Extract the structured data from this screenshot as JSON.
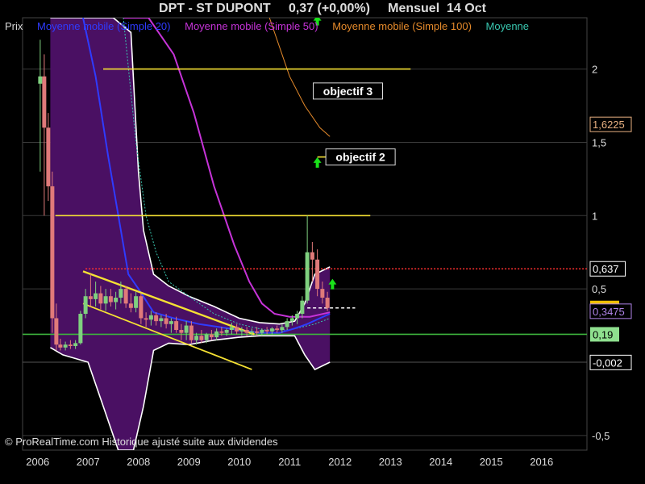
{
  "header": {
    "title": "DPT - ST DUPONT",
    "price_change": "0,37 (+0,00%)",
    "period": "Mensuel  14 Oct"
  },
  "legend": {
    "items": [
      {
        "label": "Prix",
        "color": "#d8d8d8"
      },
      {
        "label": "Moyenne mobile (Simple 20)",
        "color": "#2f3bff"
      },
      {
        "label": "Moyenne mobile (Simple 50)",
        "color": "#c633d8"
      },
      {
        "label": "Moyenne mobile (Simple 100)",
        "color": "#e58a2b"
      },
      {
        "label": "Moyenne",
        "color": "#39c7b0"
      }
    ]
  },
  "footer": {
    "credit": "© ProRealTime.com Historique ajusté suite aux dividendes"
  },
  "colors": {
    "background": "#000000",
    "band_fill": "#4a1063",
    "band_edge": "#ffffff",
    "up_candle": "#7fd07f",
    "down_candle": "#e07a7a",
    "trendline": "#f5e133",
    "support": "#3db33d",
    "resistance_dotted": "#ff3030",
    "arrow": "#19e019"
  },
  "chart_data": {
    "type": "candlestick",
    "xlim": [
      2005.7,
      2016.9
    ],
    "ylim": [
      -0.6,
      2.35
    ],
    "x_ticks": [
      {
        "x": 2006,
        "label": "2006"
      },
      {
        "x": 2007,
        "label": "2007"
      },
      {
        "x": 2008,
        "label": "2008"
      },
      {
        "x": 2009,
        "label": "2009"
      },
      {
        "x": 2010,
        "label": "2010"
      },
      {
        "x": 2011,
        "label": "2011"
      },
      {
        "x": 2012,
        "label": "2012"
      },
      {
        "x": 2013,
        "label": "2013"
      },
      {
        "x": 2014,
        "label": "2014"
      },
      {
        "x": 2015,
        "label": "2015"
      },
      {
        "x": 2016,
        "label": "2016"
      }
    ],
    "y_ticks": [
      {
        "y": 2,
        "label": "2"
      },
      {
        "y": 1.5,
        "label": "1,5"
      },
      {
        "y": 1,
        "label": "1"
      },
      {
        "y": 0.5,
        "label": "0,5"
      },
      {
        "y": -0.5,
        "label": "-0,5"
      }
    ],
    "price_tags": [
      {
        "y": 1.6225,
        "label": "1,6225",
        "style": "box",
        "color": "#e8b080"
      },
      {
        "y": 0.637,
        "label": "0,637",
        "style": "box",
        "color": "#ffffff"
      },
      {
        "y": 0.37,
        "label": "0,37",
        "style": "filled",
        "color": "#f0c000"
      },
      {
        "y": 0.3475,
        "label": "0,3475",
        "style": "box",
        "color": "#b084e8"
      },
      {
        "y": 0.19,
        "label": "0,19",
        "style": "filled",
        "color": "#8fe08f"
      },
      {
        "y": -0.002,
        "label": "-0,002",
        "style": "box",
        "color": "#ffffff"
      }
    ],
    "candles": [
      {
        "x": 2006.05,
        "o": 1.9,
        "h": 2.2,
        "l": 1.3,
        "c": 1.95
      },
      {
        "x": 2006.13,
        "o": 1.95,
        "h": 2.1,
        "l": 1.0,
        "c": 1.6
      },
      {
        "x": 2006.21,
        "o": 1.6,
        "h": 1.7,
        "l": 1.1,
        "c": 1.2
      },
      {
        "x": 2006.29,
        "o": 1.2,
        "h": 1.3,
        "l": 0.2,
        "c": 0.3
      },
      {
        "x": 2006.37,
        "o": 0.3,
        "h": 0.4,
        "l": 0.08,
        "c": 0.12
      },
      {
        "x": 2006.45,
        "o": 0.12,
        "h": 0.16,
        "l": 0.08,
        "c": 0.1
      },
      {
        "x": 2006.55,
        "o": 0.1,
        "h": 0.14,
        "l": 0.08,
        "c": 0.12
      },
      {
        "x": 2006.65,
        "o": 0.12,
        "h": 0.15,
        "l": 0.09,
        "c": 0.11
      },
      {
        "x": 2006.75,
        "o": 0.11,
        "h": 0.15,
        "l": 0.09,
        "c": 0.13
      },
      {
        "x": 2006.85,
        "o": 0.13,
        "h": 0.35,
        "l": 0.12,
        "c": 0.33
      },
      {
        "x": 2006.95,
        "o": 0.33,
        "h": 0.5,
        "l": 0.3,
        "c": 0.45
      },
      {
        "x": 2007.05,
        "o": 0.45,
        "h": 0.6,
        "l": 0.38,
        "c": 0.43
      },
      {
        "x": 2007.15,
        "o": 0.43,
        "h": 0.55,
        "l": 0.38,
        "c": 0.47
      },
      {
        "x": 2007.25,
        "o": 0.47,
        "h": 0.52,
        "l": 0.36,
        "c": 0.4
      },
      {
        "x": 2007.35,
        "o": 0.4,
        "h": 0.5,
        "l": 0.35,
        "c": 0.45
      },
      {
        "x": 2007.45,
        "o": 0.45,
        "h": 0.5,
        "l": 0.38,
        "c": 0.41
      },
      {
        "x": 2007.55,
        "o": 0.41,
        "h": 0.48,
        "l": 0.36,
        "c": 0.44
      },
      {
        "x": 2007.65,
        "o": 0.44,
        "h": 0.55,
        "l": 0.4,
        "c": 0.5
      },
      {
        "x": 2007.75,
        "o": 0.5,
        "h": 0.52,
        "l": 0.37,
        "c": 0.4
      },
      {
        "x": 2007.85,
        "o": 0.4,
        "h": 0.47,
        "l": 0.34,
        "c": 0.37
      },
      {
        "x": 2007.95,
        "o": 0.37,
        "h": 0.48,
        "l": 0.34,
        "c": 0.45
      },
      {
        "x": 2008.05,
        "o": 0.45,
        "h": 0.47,
        "l": 0.26,
        "c": 0.3
      },
      {
        "x": 2008.15,
        "o": 0.3,
        "h": 0.34,
        "l": 0.24,
        "c": 0.29
      },
      {
        "x": 2008.25,
        "o": 0.29,
        "h": 0.35,
        "l": 0.25,
        "c": 0.32
      },
      {
        "x": 2008.35,
        "o": 0.32,
        "h": 0.34,
        "l": 0.25,
        "c": 0.28
      },
      {
        "x": 2008.45,
        "o": 0.28,
        "h": 0.32,
        "l": 0.24,
        "c": 0.3
      },
      {
        "x": 2008.55,
        "o": 0.3,
        "h": 0.33,
        "l": 0.23,
        "c": 0.26
      },
      {
        "x": 2008.65,
        "o": 0.26,
        "h": 0.3,
        "l": 0.2,
        "c": 0.28
      },
      {
        "x": 2008.75,
        "o": 0.28,
        "h": 0.31,
        "l": 0.2,
        "c": 0.22
      },
      {
        "x": 2008.85,
        "o": 0.22,
        "h": 0.26,
        "l": 0.15,
        "c": 0.2
      },
      {
        "x": 2008.95,
        "o": 0.2,
        "h": 0.28,
        "l": 0.15,
        "c": 0.25
      },
      {
        "x": 2009.05,
        "o": 0.25,
        "h": 0.28,
        "l": 0.13,
        "c": 0.15
      },
      {
        "x": 2009.15,
        "o": 0.15,
        "h": 0.2,
        "l": 0.12,
        "c": 0.18
      },
      {
        "x": 2009.25,
        "o": 0.18,
        "h": 0.22,
        "l": 0.13,
        "c": 0.15
      },
      {
        "x": 2009.35,
        "o": 0.15,
        "h": 0.2,
        "l": 0.13,
        "c": 0.19
      },
      {
        "x": 2009.45,
        "o": 0.19,
        "h": 0.22,
        "l": 0.15,
        "c": 0.17
      },
      {
        "x": 2009.55,
        "o": 0.17,
        "h": 0.23,
        "l": 0.15,
        "c": 0.21
      },
      {
        "x": 2009.65,
        "o": 0.21,
        "h": 0.24,
        "l": 0.18,
        "c": 0.2
      },
      {
        "x": 2009.75,
        "o": 0.2,
        "h": 0.23,
        "l": 0.18,
        "c": 0.22
      },
      {
        "x": 2009.85,
        "o": 0.22,
        "h": 0.27,
        "l": 0.19,
        "c": 0.24
      },
      {
        "x": 2009.95,
        "o": 0.24,
        "h": 0.26,
        "l": 0.19,
        "c": 0.21
      },
      {
        "x": 2010.05,
        "o": 0.21,
        "h": 0.24,
        "l": 0.18,
        "c": 0.22
      },
      {
        "x": 2010.15,
        "o": 0.22,
        "h": 0.24,
        "l": 0.18,
        "c": 0.2
      },
      {
        "x": 2010.25,
        "o": 0.2,
        "h": 0.23,
        "l": 0.18,
        "c": 0.21
      },
      {
        "x": 2010.35,
        "o": 0.21,
        "h": 0.24,
        "l": 0.18,
        "c": 0.2
      },
      {
        "x": 2010.45,
        "o": 0.2,
        "h": 0.23,
        "l": 0.18,
        "c": 0.22
      },
      {
        "x": 2010.55,
        "o": 0.22,
        "h": 0.24,
        "l": 0.19,
        "c": 0.21
      },
      {
        "x": 2010.65,
        "o": 0.21,
        "h": 0.24,
        "l": 0.19,
        "c": 0.23
      },
      {
        "x": 2010.75,
        "o": 0.23,
        "h": 0.25,
        "l": 0.2,
        "c": 0.22
      },
      {
        "x": 2010.85,
        "o": 0.22,
        "h": 0.26,
        "l": 0.2,
        "c": 0.24
      },
      {
        "x": 2010.95,
        "o": 0.24,
        "h": 0.3,
        "l": 0.22,
        "c": 0.28
      },
      {
        "x": 2011.05,
        "o": 0.28,
        "h": 0.32,
        "l": 0.25,
        "c": 0.3
      },
      {
        "x": 2011.15,
        "o": 0.3,
        "h": 0.35,
        "l": 0.26,
        "c": 0.33
      },
      {
        "x": 2011.25,
        "o": 0.33,
        "h": 0.45,
        "l": 0.3,
        "c": 0.42
      },
      {
        "x": 2011.35,
        "o": 0.42,
        "h": 1.0,
        "l": 0.4,
        "c": 0.75
      },
      {
        "x": 2011.45,
        "o": 0.75,
        "h": 0.82,
        "l": 0.55,
        "c": 0.7
      },
      {
        "x": 2011.55,
        "o": 0.7,
        "h": 0.77,
        "l": 0.45,
        "c": 0.5
      },
      {
        "x": 2011.65,
        "o": 0.5,
        "h": 0.55,
        "l": 0.4,
        "c": 0.44
      },
      {
        "x": 2011.75,
        "o": 0.44,
        "h": 0.48,
        "l": 0.35,
        "c": 0.37
      }
    ],
    "bollinger": {
      "upper": [
        [
          2006.25,
          2.35
        ],
        [
          2006.5,
          2.35
        ],
        [
          2007,
          2.35
        ],
        [
          2007.5,
          2.35
        ],
        [
          2007.85,
          2.25
        ],
        [
          2008,
          1.3
        ],
        [
          2008.1,
          0.9
        ],
        [
          2008.3,
          0.6
        ],
        [
          2008.6,
          0.52
        ],
        [
          2009,
          0.45
        ],
        [
          2009.5,
          0.38
        ],
        [
          2010,
          0.3
        ],
        [
          2010.4,
          0.27
        ],
        [
          2010.8,
          0.26
        ],
        [
          2011.1,
          0.28
        ],
        [
          2011.3,
          0.4
        ],
        [
          2011.5,
          0.6
        ],
        [
          2011.8,
          0.65
        ]
      ],
      "lower": [
        [
          2006.25,
          0.1
        ],
        [
          2006.5,
          0.05
        ],
        [
          2007,
          0.0
        ],
        [
          2007.3,
          -0.3
        ],
        [
          2007.6,
          -0.6
        ],
        [
          2007.9,
          -0.6
        ],
        [
          2008.1,
          -0.3
        ],
        [
          2008.3,
          0.08
        ],
        [
          2008.6,
          0.13
        ],
        [
          2009,
          0.12
        ],
        [
          2009.5,
          0.15
        ],
        [
          2010,
          0.17
        ],
        [
          2010.4,
          0.18
        ],
        [
          2010.8,
          0.18
        ],
        [
          2011.1,
          0.18
        ],
        [
          2011.3,
          0.05
        ],
        [
          2011.5,
          -0.05
        ],
        [
          2011.8,
          0.0
        ]
      ]
    },
    "ma20": [
      [
        2006.9,
        2.35
      ],
      [
        2007.15,
        1.95
      ],
      [
        2007.4,
        1.4
      ],
      [
        2007.65,
        0.9
      ],
      [
        2007.8,
        0.6
      ],
      [
        2008,
        0.5
      ],
      [
        2008.3,
        0.34
      ],
      [
        2008.7,
        0.3
      ],
      [
        2009.2,
        0.26
      ],
      [
        2009.6,
        0.24
      ],
      [
        2010,
        0.22
      ],
      [
        2010.4,
        0.2
      ],
      [
        2010.8,
        0.2
      ],
      [
        2011.1,
        0.23
      ],
      [
        2011.35,
        0.26
      ],
      [
        2011.6,
        0.3
      ],
      [
        2011.8,
        0.33
      ]
    ],
    "ma50": [
      [
        2007.7,
        2.35
      ],
      [
        2008.2,
        2.35
      ],
      [
        2008.7,
        2.1
      ],
      [
        2009.1,
        1.7
      ],
      [
        2009.5,
        1.2
      ],
      [
        2009.9,
        0.8
      ],
      [
        2010.2,
        0.55
      ],
      [
        2010.45,
        0.4
      ],
      [
        2010.7,
        0.33
      ],
      [
        2011,
        0.31
      ],
      [
        2011.4,
        0.31
      ],
      [
        2011.8,
        0.34
      ]
    ],
    "ma100": [
      [
        2010.6,
        2.35
      ],
      [
        2010.8,
        2.15
      ],
      [
        2011.0,
        1.95
      ],
      [
        2011.3,
        1.75
      ],
      [
        2011.6,
        1.6
      ],
      [
        2011.8,
        1.54
      ]
    ],
    "ma_teal": [
      [
        2007.7,
        2.35
      ],
      [
        2007.95,
        1.5
      ],
      [
        2008.15,
        1.0
      ],
      [
        2008.35,
        0.75
      ],
      [
        2008.6,
        0.55
      ],
      [
        2009,
        0.45
      ],
      [
        2009.5,
        0.33
      ],
      [
        2010,
        0.26
      ],
      [
        2010.5,
        0.22
      ],
      [
        2011,
        0.22
      ],
      [
        2011.5,
        0.26
      ],
      [
        2011.8,
        0.3
      ]
    ],
    "channel_top": [
      [
        2006.9,
        0.62
      ],
      [
        2010.3,
        0.19
      ]
    ],
    "channel_bottom": [
      [
        2006.9,
        0.4
      ],
      [
        2010.25,
        -0.05
      ]
    ],
    "h_lines": [
      {
        "y": 2.0,
        "x1": 2007.3,
        "x2": 2013.4,
        "color": "#f5e133",
        "style": "solid"
      },
      {
        "y": 1.0,
        "x1": 2006.35,
        "x2": 2012.6,
        "color": "#f5e133",
        "style": "solid"
      },
      {
        "y": 1.4,
        "x1": 2011.55,
        "x2": 2011.75,
        "color": "#f5e133",
        "style": "solid"
      },
      {
        "y": 0.637,
        "x1": 2006.95,
        "x2": 2016.9,
        "color": "#ff3030",
        "style": "dotted"
      },
      {
        "y": 0.19,
        "x1": 2005.7,
        "x2": 2016.9,
        "color": "#3db33d",
        "style": "solid"
      },
      {
        "y": 0.37,
        "x1": 2011.35,
        "x2": 2012.3,
        "color": "#ffffff",
        "style": "dashed"
      }
    ],
    "annotations": [
      {
        "text": "objectif 3",
        "x": 2011.5,
        "y": 1.85
      },
      {
        "text": "objectif 2",
        "x": 2011.75,
        "y": 1.4
      }
    ],
    "arrows": [
      {
        "x": 2011.55,
        "y": 1.36
      },
      {
        "x": 2011.55,
        "y": 2.33
      },
      {
        "x": 2011.85,
        "y": 0.53
      }
    ]
  }
}
